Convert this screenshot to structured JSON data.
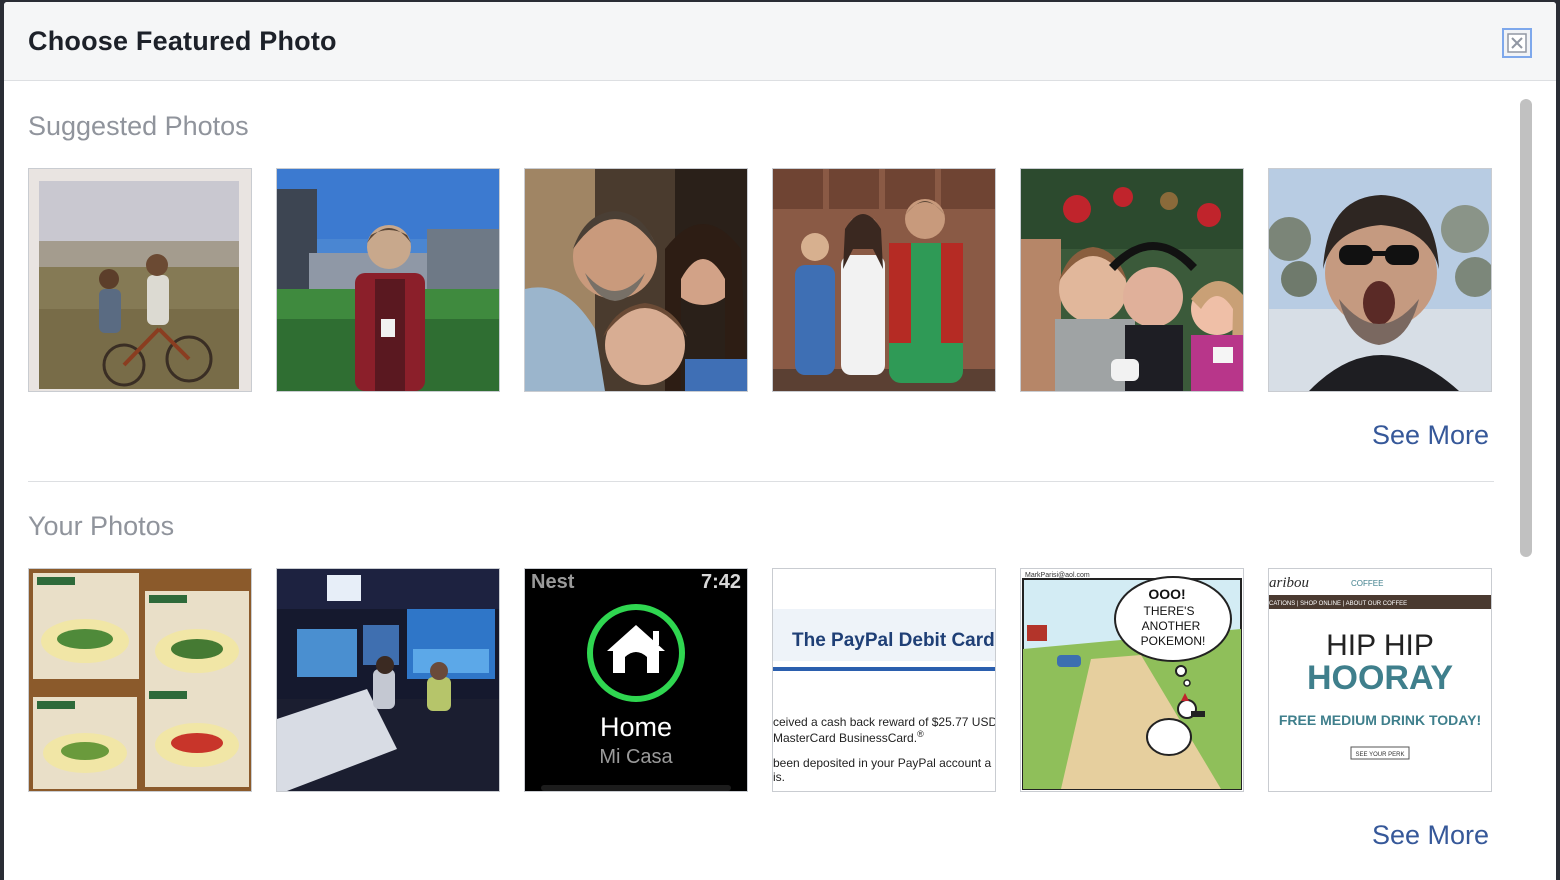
{
  "dialog": {
    "title": "Choose Featured Photo",
    "close_icon": "close-icon"
  },
  "suggested": {
    "title": "Suggested Photos",
    "see_more": "See More",
    "photos": [
      {
        "alt": "photo-girl-on-bicycle"
      },
      {
        "alt": "photo-man-at-ballpark"
      },
      {
        "alt": "photo-family-selfie"
      },
      {
        "alt": "photo-family-group"
      },
      {
        "alt": "photo-holiday-selfie"
      },
      {
        "alt": "photo-man-sunglasses"
      }
    ]
  },
  "yours": {
    "title": "Your Photos",
    "see_more": "See More",
    "photos": [
      {
        "alt": "photo-omelette-boxes"
      },
      {
        "alt": "photo-arcade-racing"
      },
      {
        "alt": "photo-nest-watch"
      },
      {
        "alt": "photo-paypal-email"
      },
      {
        "alt": "photo-pokemon-comic"
      },
      {
        "alt": "photo-caribou-coffee"
      }
    ],
    "nest": {
      "brand": "Nest",
      "time": "7:42",
      "label": "Home",
      "sublabel": "Mi Casa"
    },
    "paypal": {
      "heading": "The PayPal Debit Card",
      "line1": "ceived a cash back reward of $25.77 USD",
      "line2": "MasterCard BusinessCard.",
      "reg": "®",
      "line3": "been deposited in your PayPal account a",
      "line4": "is."
    },
    "comic": {
      "site": "MarkParisi@aol.com",
      "bubble1": "OOO!",
      "bubble2": "THERE'S",
      "bubble3": "ANOTHER",
      "bubble4": "POKEMON!"
    },
    "caribou": {
      "brand": "aribou",
      "coffee": "COFFEE",
      "nav": "CATIONS | SHOP ONLINE | ABOUT OUR COFFEE",
      "line1": "HIP HIP",
      "line2": "HOORAY",
      "line3": "FREE MEDIUM DRINK TODAY!",
      "button": "SEE YOUR PERK"
    }
  },
  "colors": {
    "link": "#365899",
    "section_title": "#90949c",
    "header_bg": "#f5f6f7",
    "nest_green": "#2fd650",
    "paypal_blue": "#1f3f76",
    "caribou_teal": "#3f7f8c"
  }
}
